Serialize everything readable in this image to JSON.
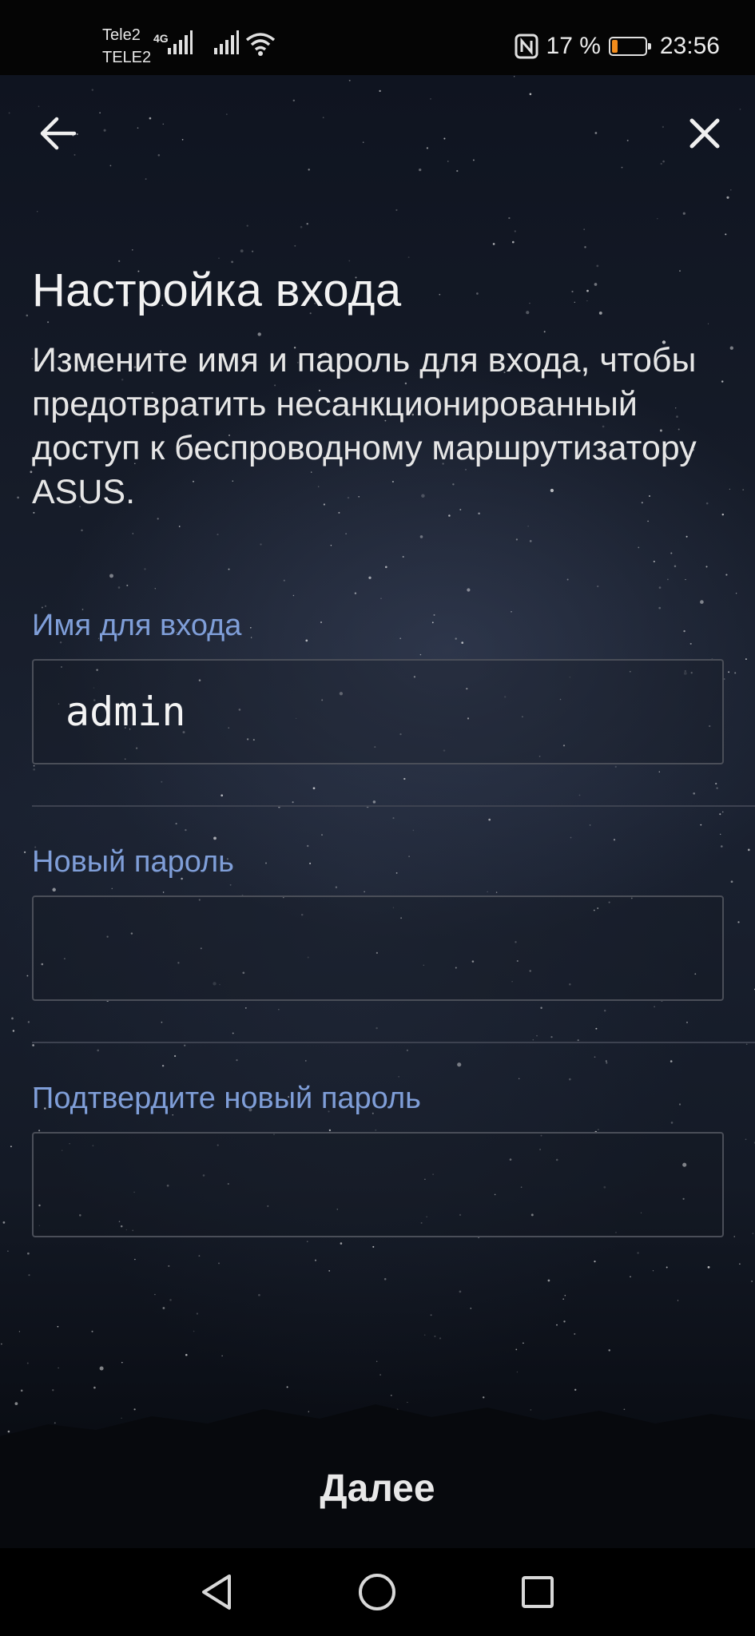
{
  "status_bar": {
    "carrier_1": "Tele2",
    "carrier_2": "TELE2",
    "network_type": "4G",
    "battery_percent": "17 %",
    "battery_level": 0.17,
    "time": "23:56",
    "icons": [
      "signal-icon",
      "signal-icon",
      "wifi-icon",
      "nfc-icon",
      "battery-icon"
    ]
  },
  "header": {
    "back_icon": "arrow-left-icon",
    "close_icon": "close-icon"
  },
  "page": {
    "title": "Настройка входа",
    "description": "Измените имя и пароль для входа, чтобы предотвратить несанкционированный доступ к беспроводному маршрутизатору ASUS."
  },
  "form": {
    "login_label": "Имя для входа",
    "login_value": "admin",
    "new_password_label": "Новый пароль",
    "new_password_value": "",
    "confirm_password_label": "Подтвердите новый пароль",
    "confirm_password_value": ""
  },
  "footer": {
    "next_label": "Далее"
  },
  "nav_bar": {
    "back_icon": "triangle-back-icon",
    "home_icon": "circle-home-icon",
    "recents_icon": "square-recents-icon"
  },
  "colors": {
    "accent_label": "#7f9ed8",
    "battery_low": "#f28c1c"
  }
}
